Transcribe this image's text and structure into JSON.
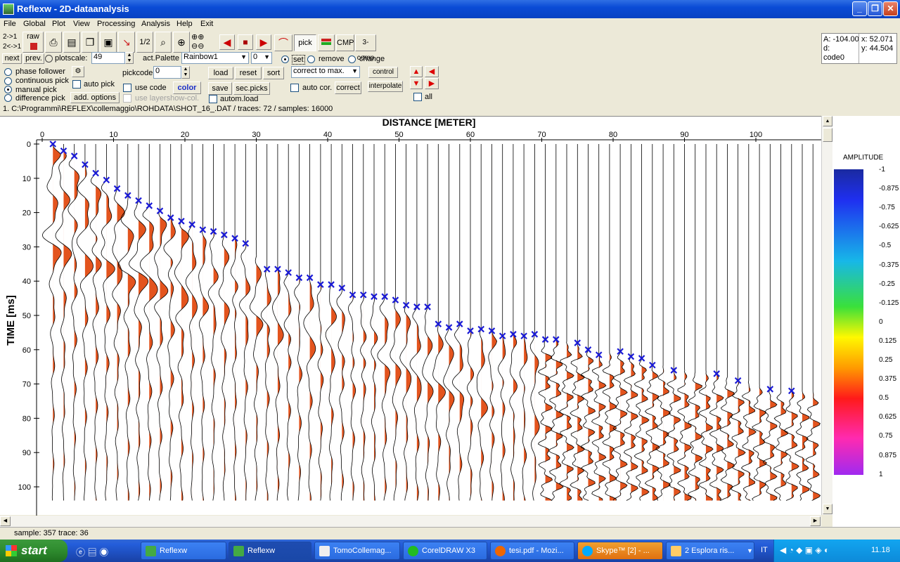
{
  "window": {
    "title": "Reflexw - 2D-dataanalysis",
    "min": "_",
    "max": "❐",
    "close": "✕"
  },
  "menu": [
    "File",
    "Global",
    "Plot",
    "View",
    "Processing",
    "Analysis",
    "Help",
    "Exit"
  ],
  "toolbar": {
    "arrow_top": "2->1",
    "arrow_bottom": "2<->1",
    "raw": "raw",
    "half": "1/2",
    "next": "next",
    "prev": "prev.",
    "plotscale_label": "plotscale:",
    "plotscale": "49",
    "palette_label": "act.Palette",
    "palette": "Rainbow1",
    "palette_num": "0",
    "pick": "pick",
    "cmp": "CMP",
    "comp3": "3-comp",
    "set": "set",
    "remove": "remove",
    "change": "change"
  },
  "readout": {
    "a": "A: -104.00",
    "d": "d:",
    "code": "code0",
    "x": "x: 52.071",
    "y": "y: 44.504"
  },
  "pickpanel": {
    "phase_follower": "phase follower",
    "continuous_pick": "continuous pick",
    "manual_pick": "manual pick",
    "difference_pick": "difference pick",
    "auto_pick": "auto pick",
    "add_options": "add. options",
    "pickcode_label": "pickcode",
    "pickcode": "0",
    "use_code": "use code",
    "color": "color",
    "use_layershow": "use layershow-col.",
    "load": "load",
    "reset": "reset",
    "sort": "sort",
    "save": "save",
    "sec_picks": "sec.picks",
    "autom_load": "autom.load",
    "correct_mode": "correct to max.",
    "control": "control",
    "auto_cor": "auto cor.",
    "correct": "correct",
    "interpolate": "interpolate",
    "all": "all"
  },
  "file_info": "1. C:\\Programmi\\REFLEX\\collemaggio\\ROHDATA\\SHOT_16_.DAT / traces: 72 / samples: 16000",
  "chart_data": {
    "type": "seismic-wiggle",
    "title": "DISTANCE [METER]",
    "ylabel": "TIME [ms]",
    "xlim": [
      0,
      108
    ],
    "ylim": [
      0,
      104
    ],
    "x_ticks": [
      0,
      10,
      20,
      30,
      40,
      50,
      60,
      70,
      80,
      90,
      100
    ],
    "y_ticks": [
      0,
      10,
      20,
      30,
      40,
      50,
      60,
      70,
      80,
      90,
      100
    ],
    "fill_color": "#E3541E",
    "trace_count": 72,
    "picks": [
      {
        "x": 1.5,
        "y": 0
      },
      {
        "x": 3,
        "y": 2
      },
      {
        "x": 4.5,
        "y": 3.5
      },
      {
        "x": 6,
        "y": 6
      },
      {
        "x": 7.5,
        "y": 8.5
      },
      {
        "x": 9,
        "y": 10.5
      },
      {
        "x": 10.5,
        "y": 13
      },
      {
        "x": 12,
        "y": 15
      },
      {
        "x": 13.5,
        "y": 16.5
      },
      {
        "x": 15,
        "y": 18
      },
      {
        "x": 16.5,
        "y": 19.5
      },
      {
        "x": 18,
        "y": 21.5
      },
      {
        "x": 19.5,
        "y": 22.5
      },
      {
        "x": 21,
        "y": 23.5
      },
      {
        "x": 22.5,
        "y": 25
      },
      {
        "x": 24,
        "y": 25.5
      },
      {
        "x": 25.5,
        "y": 26.5
      },
      {
        "x": 27,
        "y": 27.5
      },
      {
        "x": 28.5,
        "y": 29
      },
      {
        "x": 31.5,
        "y": 36.5
      },
      {
        "x": 33,
        "y": 36.5
      },
      {
        "x": 34.5,
        "y": 37.5
      },
      {
        "x": 36,
        "y": 39
      },
      {
        "x": 37.5,
        "y": 39
      },
      {
        "x": 39,
        "y": 41
      },
      {
        "x": 40.5,
        "y": 41
      },
      {
        "x": 42,
        "y": 42
      },
      {
        "x": 43.5,
        "y": 44
      },
      {
        "x": 45,
        "y": 44
      },
      {
        "x": 46.5,
        "y": 44.5
      },
      {
        "x": 48,
        "y": 44.5
      },
      {
        "x": 49.5,
        "y": 45.5
      },
      {
        "x": 51,
        "y": 47
      },
      {
        "x": 52.5,
        "y": 47.5
      },
      {
        "x": 54,
        "y": 47.5
      },
      {
        "x": 55.5,
        "y": 52.5
      },
      {
        "x": 57,
        "y": 53.5
      },
      {
        "x": 58.5,
        "y": 52.5
      },
      {
        "x": 60,
        "y": 54.5
      },
      {
        "x": 61.5,
        "y": 54
      },
      {
        "x": 63,
        "y": 54.5
      },
      {
        "x": 64.5,
        "y": 56
      },
      {
        "x": 66,
        "y": 55.5
      },
      {
        "x": 67.5,
        "y": 56
      },
      {
        "x": 69,
        "y": 55.5
      },
      {
        "x": 70.5,
        "y": 57
      },
      {
        "x": 72,
        "y": 57
      },
      {
        "x": 75,
        "y": 58
      },
      {
        "x": 76.5,
        "y": 60
      },
      {
        "x": 78,
        "y": 61.5
      },
      {
        "x": 81,
        "y": 60.5
      },
      {
        "x": 82.5,
        "y": 62
      },
      {
        "x": 84,
        "y": 62.5
      },
      {
        "x": 85.5,
        "y": 64.5
      },
      {
        "x": 88.5,
        "y": 66
      },
      {
        "x": 94.5,
        "y": 67
      },
      {
        "x": 97.5,
        "y": 69
      },
      {
        "x": 102,
        "y": 71.5
      },
      {
        "x": 105,
        "y": 72
      }
    ]
  },
  "legend": {
    "title": "AMPLITUDE",
    "ticks": [
      "-1",
      "-0.875",
      "-0.75",
      "-0.625",
      "-0.5",
      "-0.375",
      "-0.25",
      "-0.125",
      "0",
      "0.125",
      "0.25",
      "0.375",
      "0.5",
      "0.625",
      "0.75",
      "0.875",
      "1"
    ]
  },
  "status": "sample: 357 trace: 36",
  "taskbar": {
    "start": "start",
    "tasks": [
      "Reflexw",
      "Reflexw",
      "TomoCollemag...",
      "CorelDRAW X3",
      "tesi.pdf - Mozi...",
      "Skype™ [2] - ...",
      "2 Esplora ris..."
    ],
    "lang": "IT",
    "clock": "11.18"
  }
}
